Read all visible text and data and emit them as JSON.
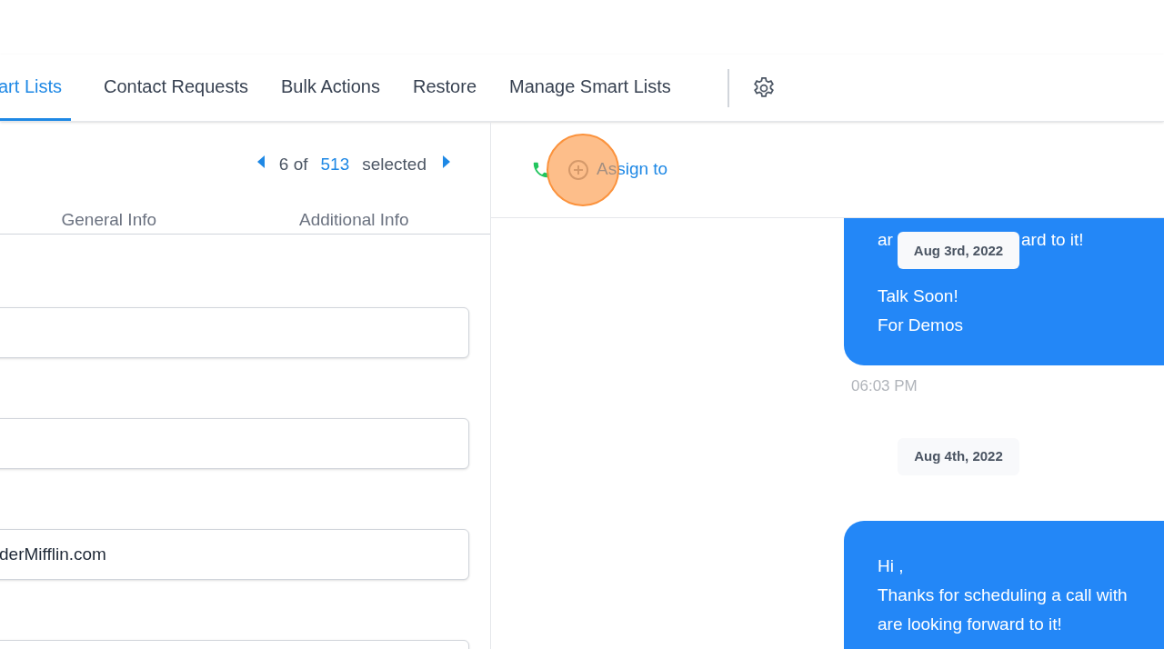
{
  "tabs": [
    {
      "label": "art Lists",
      "selected": true
    },
    {
      "label": "Contact Requests",
      "selected": false
    },
    {
      "label": "Bulk Actions",
      "selected": false
    },
    {
      "label": "Restore",
      "selected": false
    },
    {
      "label": "Manage Smart Lists",
      "selected": false
    }
  ],
  "pager": {
    "current": "6 of",
    "total": "513",
    "suffix": "selected"
  },
  "detail_tabs": [
    {
      "label": "General Info",
      "selected": false
    },
    {
      "label": "Additional Info",
      "selected": false
    }
  ],
  "fields": [
    {
      "kind": "blank"
    },
    {
      "kind": "blank"
    },
    {
      "kind": "text",
      "value": "derMifflin.com"
    },
    {
      "kind": "blank"
    }
  ],
  "chat_header": {
    "assign_label": "Assign to"
  },
  "click_highlight": true,
  "messages": [
    {
      "kind": "bubble",
      "line_start": "ar",
      "line_end": "ard to it!",
      "chip": "Aug 3rd, 2022",
      "lines": [
        "Talk Soon!",
        "For Demos"
      ],
      "time": "06:03 PM"
    },
    {
      "kind": "date",
      "text": "Aug 4th, 2022"
    },
    {
      "kind": "bubble",
      "lines": [
        "Hi ,",
        "Thanks for scheduling a call with",
        "are looking forward to it!"
      ]
    }
  ]
}
